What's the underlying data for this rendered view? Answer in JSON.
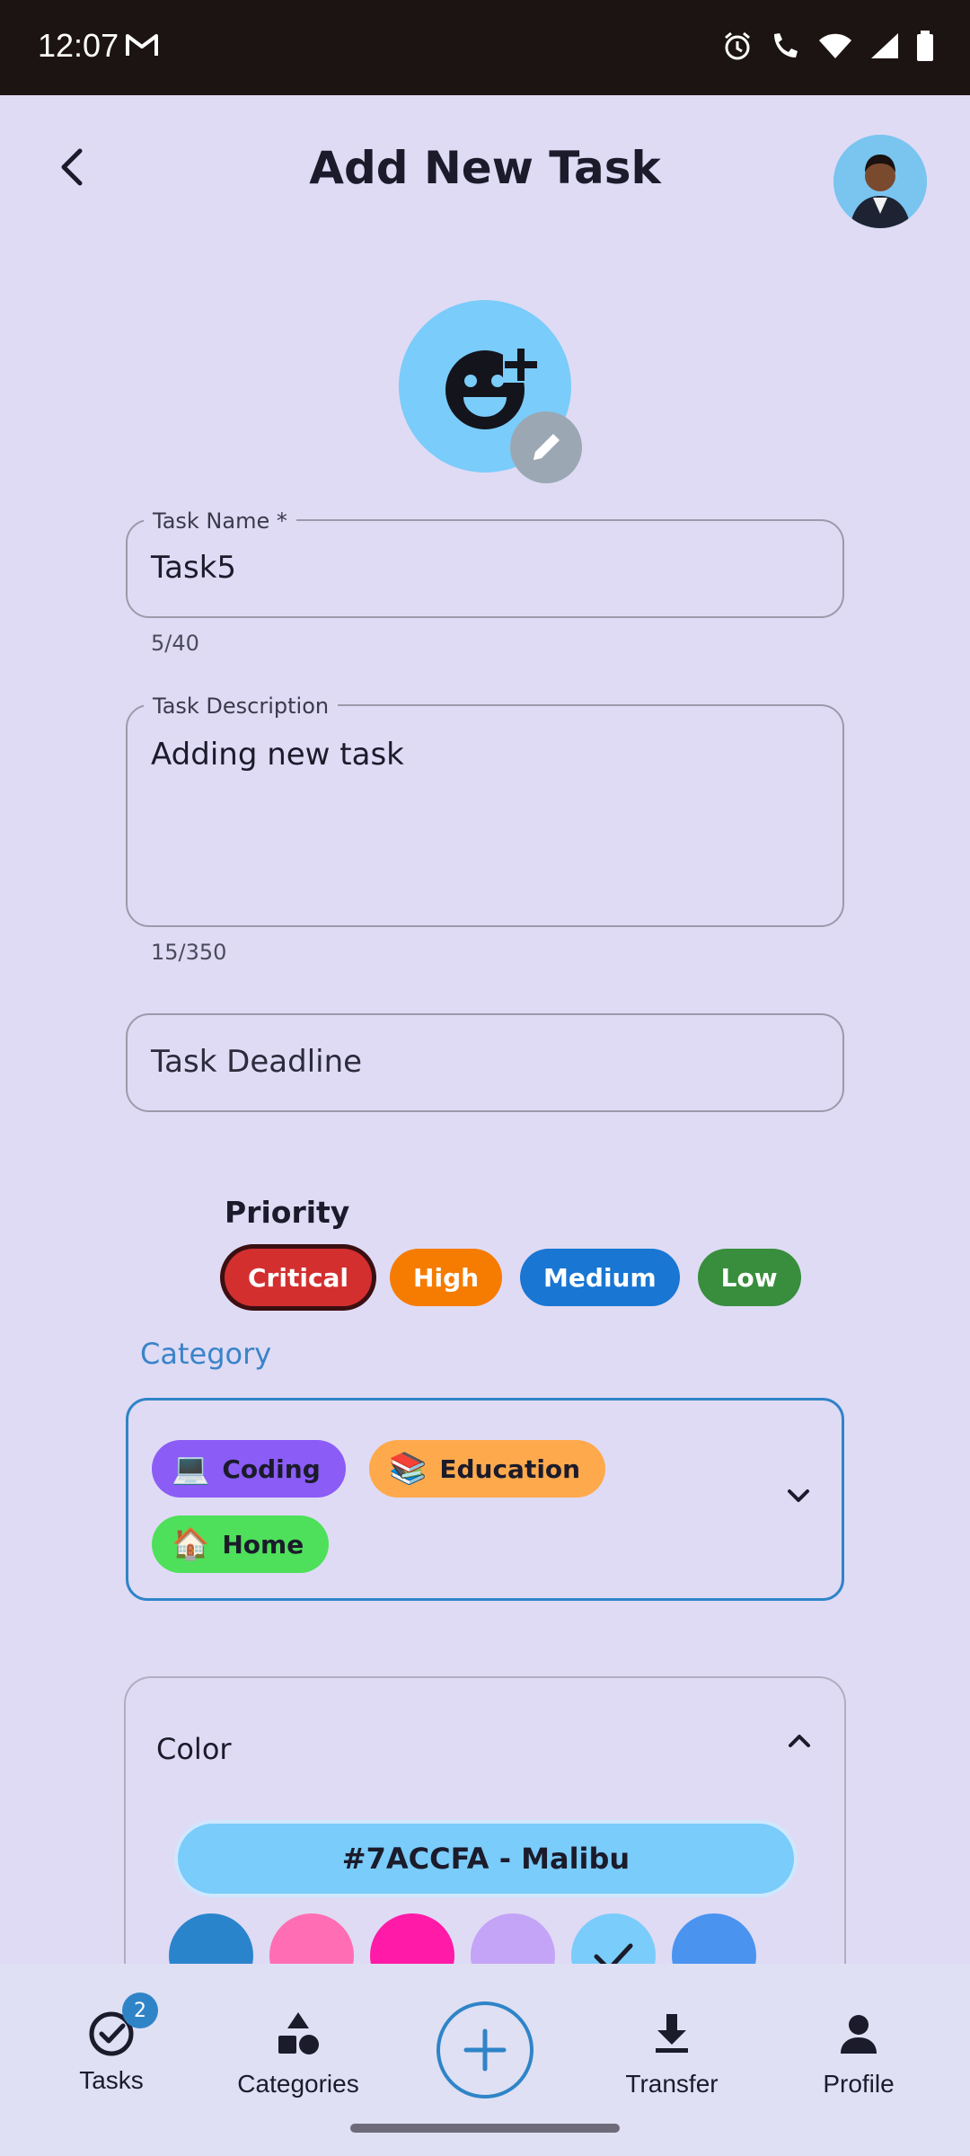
{
  "status_bar": {
    "time": "12:07"
  },
  "header": {
    "title": "Add New Task"
  },
  "form": {
    "task_name": {
      "label": "Task Name *",
      "value": "Task5",
      "counter": "5/40"
    },
    "task_description": {
      "label": "Task Description",
      "value": "Adding new task",
      "counter": "15/350"
    },
    "task_deadline": {
      "placeholder": "Task Deadline"
    }
  },
  "priority": {
    "label": "Priority",
    "options": [
      {
        "label": "Critical",
        "color": "#d32f2f",
        "selected": true
      },
      {
        "label": "High",
        "color": "#f57c00",
        "selected": false
      },
      {
        "label": "Medium",
        "color": "#1976d2",
        "selected": false
      },
      {
        "label": "Low",
        "color": "#388e3c",
        "selected": false
      }
    ]
  },
  "category": {
    "label": "Category",
    "selected": [
      {
        "icon": "💻",
        "label": "Coding",
        "color": "#8b5cf6"
      },
      {
        "icon": "📚",
        "label": "Education",
        "color": "#ffa94d"
      },
      {
        "icon": "🏠",
        "label": "Home",
        "color": "#4ee05a"
      }
    ]
  },
  "color": {
    "title": "Color",
    "selected_label": "#7ACCFA - Malibu",
    "swatches": [
      "#2a84cc",
      "#ff6eb4",
      "#ff1aa8",
      "#c4a4f7",
      "#7accfa",
      "#4a94f0"
    ],
    "selected_index": 4
  },
  "bottom_nav": {
    "tasks": {
      "label": "Tasks",
      "badge": "2"
    },
    "categories": {
      "label": "Categories"
    },
    "transfer": {
      "label": "Transfer"
    },
    "profile": {
      "label": "Profile"
    }
  }
}
